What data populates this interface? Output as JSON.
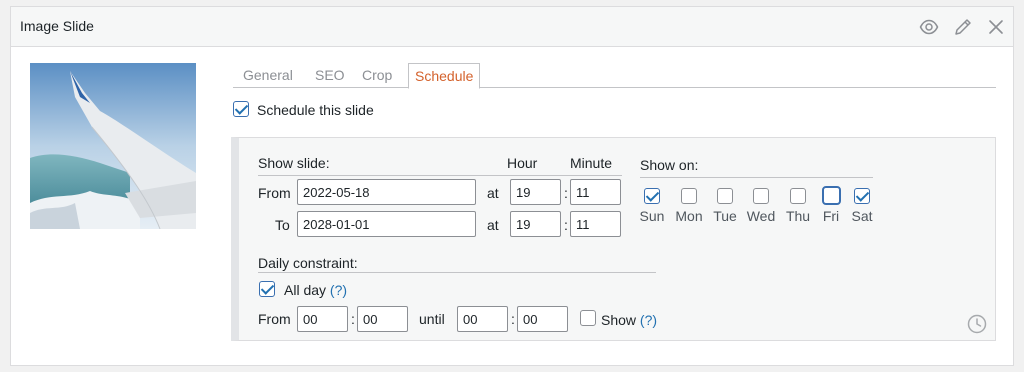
{
  "panel": {
    "title": "Image Slide"
  },
  "tabs": [
    "General",
    "SEO",
    "Crop",
    "Schedule"
  ],
  "schedule_this_slide": {
    "label": "Schedule this slide",
    "checked": true
  },
  "show_slide": {
    "heading": "Show slide:",
    "hour_heading": "Hour",
    "minute_heading": "Minute",
    "from_label": "From",
    "to_label": "To",
    "at_label": "at",
    "colon": ":",
    "from": {
      "date": "2022-05-18",
      "hour": "19",
      "minute": "11"
    },
    "to": {
      "date": "2028-01-01",
      "hour": "19",
      "minute": "11"
    }
  },
  "show_on": {
    "heading": "Show on:",
    "days": [
      {
        "label": "Sun",
        "checked": true
      },
      {
        "label": "Mon",
        "checked": false
      },
      {
        "label": "Tue",
        "checked": false
      },
      {
        "label": "Wed",
        "checked": false
      },
      {
        "label": "Thu",
        "checked": false
      },
      {
        "label": "Fri",
        "checked": false
      },
      {
        "label": "Sat",
        "checked": true
      }
    ]
  },
  "daily": {
    "heading": "Daily constraint:",
    "all_day_label": "All day",
    "all_day_checked": true,
    "help": "(?)",
    "from_label": "From",
    "until_label": "until",
    "colon": ":",
    "from_hour": "00",
    "from_minute": "00",
    "until_hour": "00",
    "until_minute": "00",
    "show_label": "Show",
    "show_checked": false
  },
  "icons": [
    "eye-icon",
    "pencil-icon",
    "close-icon",
    "clock-icon"
  ],
  "colors": {
    "active_tab": "#d4622c",
    "checkbox": "#2271b1"
  }
}
